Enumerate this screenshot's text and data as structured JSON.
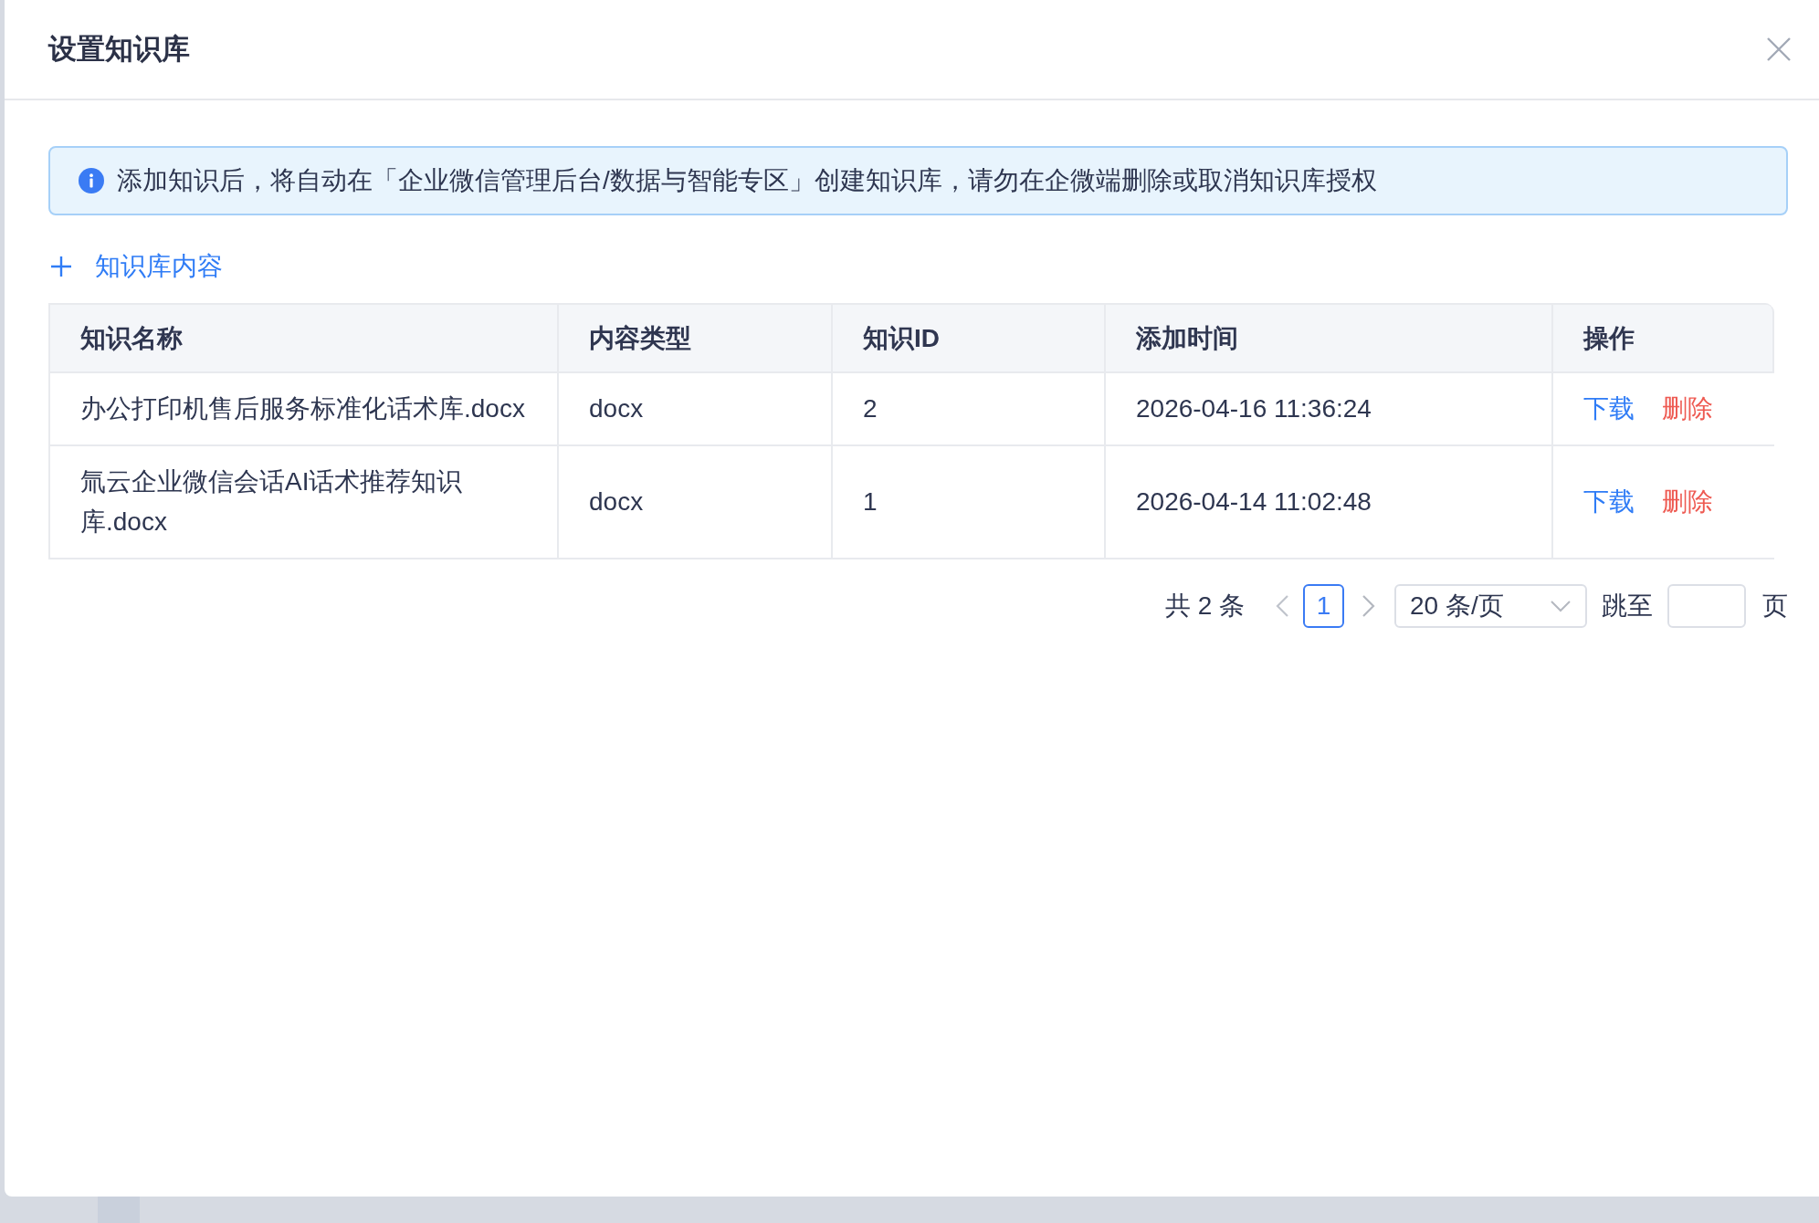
{
  "dialog": {
    "title": "设置知识库"
  },
  "notice": {
    "text": "添加知识后，将自动在「企业微信管理后台/数据与智能专区」创建知识库，请勿在企微端删除或取消知识库授权"
  },
  "add_button": {
    "label": "知识库内容"
  },
  "table": {
    "columns": [
      "知识名称",
      "内容类型",
      "知识ID",
      "添加时间",
      "操作"
    ],
    "rows": [
      {
        "name": "办公打印机售后服务标准化话术库.docx",
        "type": "docx",
        "id": "2",
        "added": "2026-04-16 11:36:24",
        "actions": [
          {
            "label": "下载",
            "kind": "download"
          },
          {
            "label": "删除",
            "kind": "delete"
          }
        ]
      },
      {
        "name": "氚云企业微信会话AI话术推荐知识库.docx",
        "type": "docx",
        "id": "1",
        "added": "2026-04-14 11:02:48",
        "actions": [
          {
            "label": "下载",
            "kind": "download"
          },
          {
            "label": "删除",
            "kind": "delete"
          }
        ]
      }
    ]
  },
  "pagination": {
    "total": "共 2 条",
    "pages": [
      {
        "label": "1",
        "selected": true
      }
    ],
    "page_size": "20 条/页",
    "jump_label": "跳至",
    "jump_suffix": "页"
  }
}
